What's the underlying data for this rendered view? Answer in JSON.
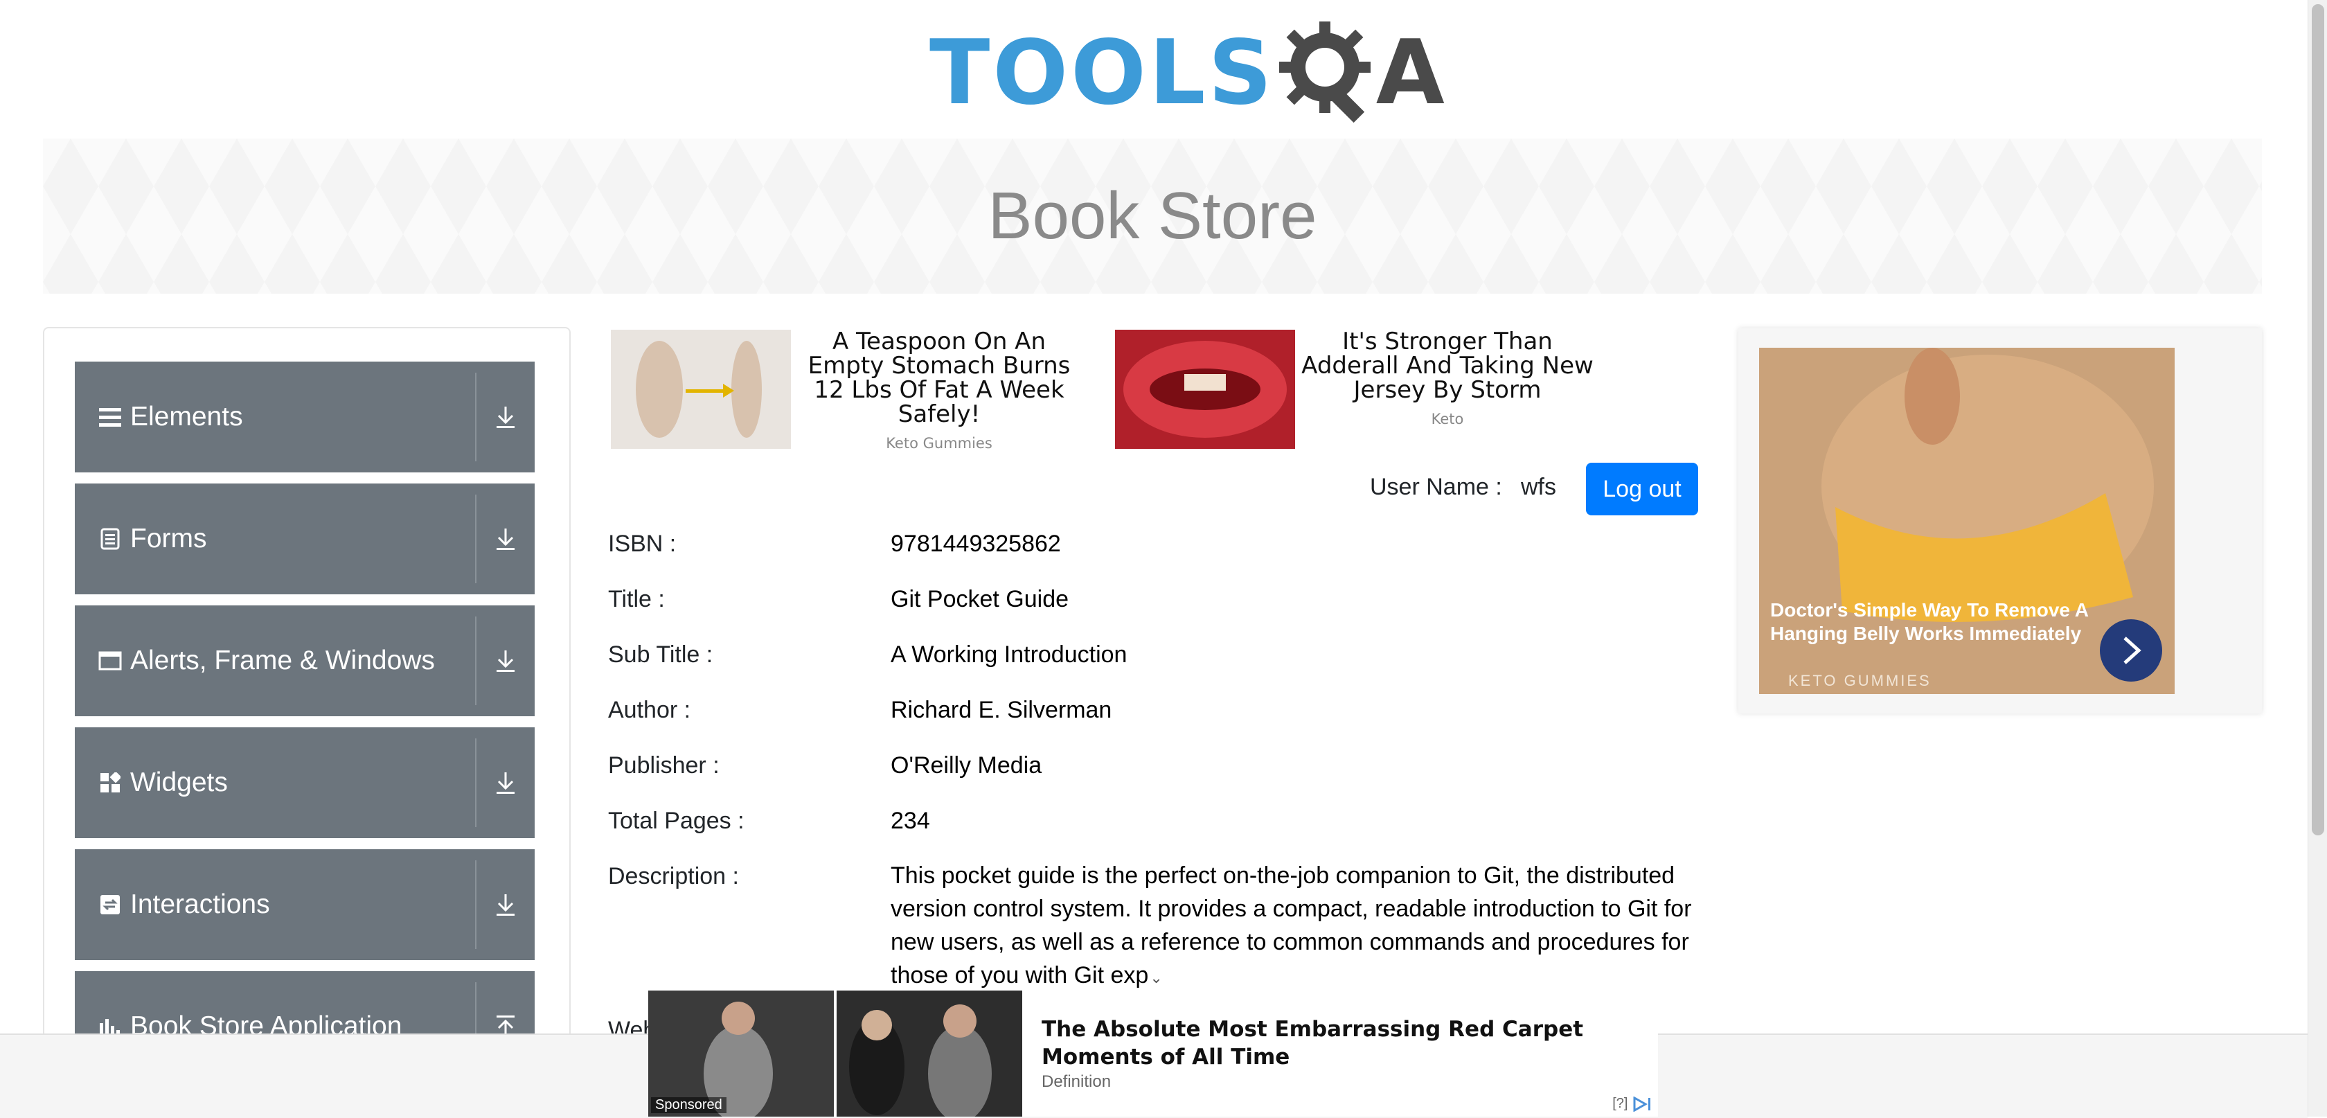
{
  "logo": {
    "text": "TOOLS",
    "tail": "A"
  },
  "banner": {
    "title": "Book Store"
  },
  "sidebar": {
    "groups": [
      {
        "label": "Elements",
        "icon": "hamburger-icon"
      },
      {
        "label": "Forms",
        "icon": "document-icon"
      },
      {
        "label": "Alerts, Frame & Windows",
        "icon": "window-icon"
      },
      {
        "label": "Widgets",
        "icon": "widgets-icon"
      },
      {
        "label": "Interactions",
        "icon": "interactions-icon"
      },
      {
        "label": "Book Store Application",
        "icon": "bar-chart-icon"
      }
    ]
  },
  "ads_top": [
    {
      "headline": "A Teaspoon On An Empty Stomach Burns 12 Lbs Of Fat A Week Safely!",
      "source": "Keto Gummies"
    },
    {
      "headline": "It's Stronger Than Adderall And Taking New Jersey By Storm",
      "source": "Keto"
    }
  ],
  "user": {
    "label": "User Name :",
    "name": "wfs",
    "logout": "Log out"
  },
  "book": {
    "isbn": {
      "label": "ISBN :",
      "value": "9781449325862"
    },
    "title": {
      "label": "Title :",
      "value": "Git Pocket Guide"
    },
    "subtitle": {
      "label": "Sub Title :",
      "value": "A Working Introduction"
    },
    "author": {
      "label": "Author :",
      "value": "Richard E. Silverman"
    },
    "publisher": {
      "label": "Publisher :",
      "value": "O'Reilly Media"
    },
    "pages": {
      "label": "Total Pages :",
      "value": "234"
    },
    "description": {
      "label": "Description :",
      "value": "This pocket guide is the perfect on-the-job companion to Git, the distributed version control system. It provides a compact, readable introduction to Git for new users, as well as a reference to common commands and procedures for those of you with Git exp"
    },
    "website_partial": "Web"
  },
  "ad_right": {
    "headline": "Doctor's Simple Way To Remove A Hanging Belly Works Immediately",
    "source": "KETO GUMMIES"
  },
  "ad_bottom": {
    "headline": "The Absolute Most Embarrassing Red Carpet Moments of All Time",
    "source": "Definition",
    "sponsored": "Sponsored",
    "info": "[?]"
  },
  "colors": {
    "sidebar_group": "#6c757d",
    "primary": "#007bff",
    "logo_blue": "#3d9bd8"
  }
}
